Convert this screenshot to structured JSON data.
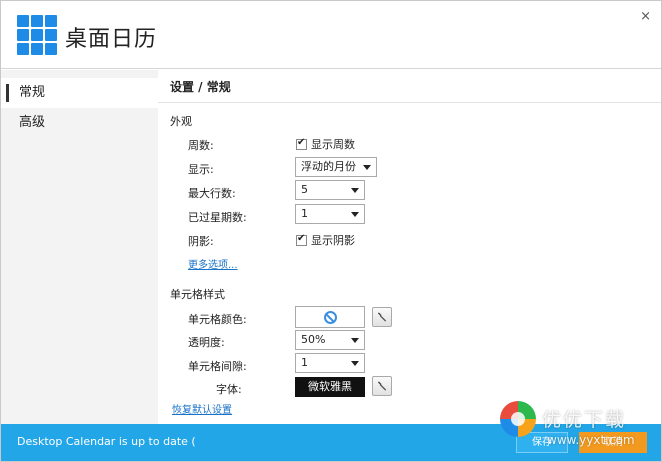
{
  "app": {
    "title": "桌面日历"
  },
  "window": {
    "close_label": "×"
  },
  "sidebar": {
    "items": [
      {
        "label": "常规",
        "active": true
      },
      {
        "label": "高级",
        "active": false
      }
    ]
  },
  "content": {
    "breadcrumb": "设置 / 常规",
    "appearance": {
      "section_title": "外观",
      "rows": {
        "weeks_label": "周数:",
        "weeks_checkbox": "显示周数",
        "display_label": "显示:",
        "display_value": "浮动的月份",
        "max_rows_label": "最大行数:",
        "max_rows_value": "5",
        "past_weeks_label": "已过星期数:",
        "past_weeks_value": "1",
        "shadow_label": "阴影:",
        "shadow_checkbox": "显示阴影"
      },
      "more_options_link": "更多选项..."
    },
    "cell_style": {
      "section_title": "单元格样式",
      "rows": {
        "cell_color_label": "单元格颜色:",
        "opacity_label": "透明度:",
        "opacity_value": "50%",
        "cell_spacing_label": "单元格间隙:",
        "cell_spacing_value": "1",
        "font_label": "字体:",
        "font_value": "微软雅黑"
      },
      "restore_link": "恢复默认设置"
    }
  },
  "statusbar": {
    "text": "Desktop Calendar is up to date (",
    "button1_label": "保存",
    "button2_label": "取消",
    "color": "#22a6e8",
    "accent": "#f29a1f"
  },
  "watermark": {
    "text": "优优下载",
    "url": "www.yyxt.com"
  }
}
